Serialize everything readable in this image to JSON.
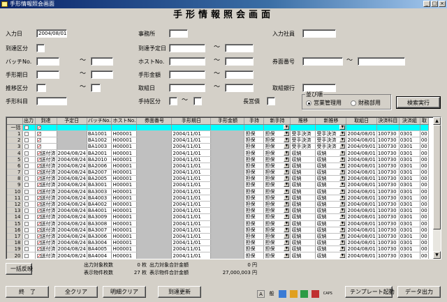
{
  "window": {
    "title": "手形情報照会画面"
  },
  "heading": "手形情報照会画面",
  "filters": {
    "input_date": {
      "label": "入力日",
      "value": "2004/08/01"
    },
    "office": {
      "label": "事務所",
      "value": ""
    },
    "input_staff": {
      "label": "入力社員",
      "value": ""
    },
    "arrival_class": {
      "label": "到達区分",
      "value": ""
    },
    "arrival_plan_date": {
      "label": "到達予定日",
      "from": "",
      "to": ""
    },
    "batch_no": {
      "label": "バッチNo.",
      "from": "",
      "to": ""
    },
    "host_no": {
      "label": "ホストNo.",
      "from": "",
      "to": ""
    },
    "bill_no": {
      "label": "券面番号",
      "from": "",
      "to": ""
    },
    "bill_due": {
      "label": "手形期日",
      "from": "",
      "to": ""
    },
    "bill_amount": {
      "label": "手形金額",
      "from": "",
      "to": ""
    },
    "transfer_class": {
      "label": "推移区分",
      "from": "",
      "to": ""
    },
    "deal_date": {
      "label": "取組日",
      "from": "",
      "to": ""
    },
    "deal_bank": {
      "label": "取組銀行",
      "value": ""
    },
    "bill_subject": {
      "label": "手形科目",
      "value": ""
    },
    "bill_hand_class": {
      "label": "手持区分",
      "from": "",
      "to": ""
    },
    "long_term": {
      "label": "長営債",
      "value": ""
    }
  },
  "sort_order": {
    "label": "並び順",
    "options": [
      "営業管理用",
      "財務部用"
    ],
    "selected": 0
  },
  "buttons": {
    "search": "検索実行",
    "bulk_apply": "一括反映",
    "exit": "終　了",
    "clear_all": "全クリア",
    "clear_detail": "明細クリア",
    "update_arrival": "到達更新",
    "template": "テンプレート起動",
    "data_output": "データ出力"
  },
  "grid": {
    "columns": [
      "",
      "出力",
      "到達",
      "予定日",
      "バッチNo.",
      "ホストNo.",
      "券面番号",
      "手形期日",
      "手形金額",
      "手持",
      "新手持",
      "推移",
      "新推移",
      "取組日",
      "決済科目",
      "決済組",
      "取"
    ],
    "bulk_label": "一括",
    "rows": [
      {
        "n": "1",
        "arr": "",
        "plan": "",
        "batch": "BA1001",
        "host": "H00001",
        "due": "2004/11/01",
        "hold": "担保",
        "nhold": "担保",
        "tr": "受手決済",
        "ntr": "受手決済",
        "deal": "2004/08/01",
        "subj": "100730",
        "grp": "0301",
        "x": "00"
      },
      {
        "n": "2",
        "arr": "",
        "plan": "",
        "batch": "BA1002",
        "host": "H00001",
        "due": "2004/11/01",
        "hold": "担保",
        "nhold": "担保",
        "tr": "受手決済",
        "ntr": "受手決済",
        "deal": "2004/08/01",
        "subj": "100730",
        "grp": "0301",
        "x": "00"
      },
      {
        "n": "3",
        "arr": "",
        "plan": "",
        "batch": "BA1003",
        "host": "H00001",
        "due": "2004/11/01",
        "hold": "担保",
        "nhold": "担保",
        "tr": "受手決済",
        "ntr": "受手決済",
        "deal": "2004/09/01",
        "subj": "100730",
        "grp": "0301",
        "x": "00"
      },
      {
        "n": "4",
        "arr": "送付済",
        "plan": "2004/08/24",
        "batch": "BA2001",
        "host": "H00001",
        "due": "2004/11/01",
        "hold": "担保",
        "nhold": "担保",
        "tr": "収納",
        "ntr": "収納",
        "deal": "2004/08/01",
        "subj": "100730",
        "grp": "0301",
        "x": "00"
      },
      {
        "n": "5",
        "arr": "送付済",
        "plan": "2004/08/24",
        "batch": "BA2010",
        "host": "H00001",
        "due": "2004/11/01",
        "hold": "担保",
        "nhold": "担保",
        "tr": "収納",
        "ntr": "収納",
        "deal": "2004/08/01",
        "subj": "100730",
        "grp": "0301",
        "x": "00"
      },
      {
        "n": "6",
        "arr": "送付済",
        "plan": "2004/08/24",
        "batch": "BA2006",
        "host": "H00001",
        "due": "2004/11/01",
        "hold": "担保",
        "nhold": "担保",
        "tr": "収納",
        "ntr": "収納",
        "deal": "2004/08/01",
        "subj": "100730",
        "grp": "0301",
        "x": "00"
      },
      {
        "n": "7",
        "arr": "送付済",
        "plan": "2004/08/24",
        "batch": "BA2007",
        "host": "H00001",
        "due": "2004/11/01",
        "hold": "担保",
        "nhold": "担保",
        "tr": "収納",
        "ntr": "収納",
        "deal": "2004/08/01",
        "subj": "100730",
        "grp": "0301",
        "x": "00"
      },
      {
        "n": "8",
        "arr": "送付済",
        "plan": "2004/08/24",
        "batch": "BA2005",
        "host": "H00001",
        "due": "2004/11/01",
        "hold": "担保",
        "nhold": "担保",
        "tr": "収納",
        "ntr": "収納",
        "deal": "2004/08/01",
        "subj": "100730",
        "grp": "0301",
        "x": "00"
      },
      {
        "n": "9",
        "arr": "送付済",
        "plan": "2004/08/24",
        "batch": "BA3001",
        "host": "H00001",
        "due": "2004/11/01",
        "hold": "担保",
        "nhold": "担保",
        "tr": "収納",
        "ntr": "収納",
        "deal": "2004/08/01",
        "subj": "100730",
        "grp": "0301",
        "x": "00"
      },
      {
        "n": "10",
        "arr": "送付済",
        "plan": "2004/08/24",
        "batch": "BA3003",
        "host": "H00001",
        "due": "2004/11/01",
        "hold": "担保",
        "nhold": "担保",
        "tr": "収納",
        "ntr": "収納",
        "deal": "2004/08/01",
        "subj": "100730",
        "grp": "0301",
        "x": "00"
      },
      {
        "n": "11",
        "arr": "送付済",
        "plan": "2004/08/24",
        "batch": "BA4003",
        "host": "H00001",
        "due": "2004/11/01",
        "hold": "担保",
        "nhold": "担保",
        "tr": "収納",
        "ntr": "収納",
        "deal": "2004/08/01",
        "subj": "100730",
        "grp": "0301",
        "x": "00"
      },
      {
        "n": "12",
        "arr": "送付済",
        "plan": "2004/08/24",
        "batch": "BA4002",
        "host": "H00001",
        "due": "2004/11/01",
        "hold": "担保",
        "nhold": "担保",
        "tr": "収納",
        "ntr": "収納",
        "deal": "2004/08/01",
        "subj": "100730",
        "grp": "0301",
        "x": "00"
      },
      {
        "n": "13",
        "arr": "送付済",
        "plan": "2004/08/24",
        "batch": "BA4001",
        "host": "H00001",
        "due": "2004/11/01",
        "hold": "担保",
        "nhold": "担保",
        "tr": "収納",
        "ntr": "収納",
        "deal": "2004/08/01",
        "subj": "100730",
        "grp": "0301",
        "x": "00"
      },
      {
        "n": "14",
        "arr": "送付済",
        "plan": "2004/08/24",
        "batch": "BA3009",
        "host": "H00001",
        "due": "2004/11/01",
        "hold": "担保",
        "nhold": "担保",
        "tr": "収納",
        "ntr": "収納",
        "deal": "2004/08/01",
        "subj": "100730",
        "grp": "0301",
        "x": "00"
      },
      {
        "n": "15",
        "arr": "送付済",
        "plan": "2004/08/24",
        "batch": "BA3008",
        "host": "H00001",
        "due": "2004/11/01",
        "hold": "担保",
        "nhold": "担保",
        "tr": "収納",
        "ntr": "収納",
        "deal": "2004/08/01",
        "subj": "100730",
        "grp": "0301",
        "x": "00"
      },
      {
        "n": "16",
        "arr": "送付済",
        "plan": "2004/08/24",
        "batch": "BA3007",
        "host": "H00001",
        "due": "2004/11/01",
        "hold": "担保",
        "nhold": "担保",
        "tr": "収納",
        "ntr": "収納",
        "deal": "2004/08/01",
        "subj": "100730",
        "grp": "0301",
        "x": "00"
      },
      {
        "n": "17",
        "arr": "送付済",
        "plan": "2004/08/24",
        "batch": "BA3006",
        "host": "H00001",
        "due": "2004/11/01",
        "hold": "担保",
        "nhold": "担保",
        "tr": "収納",
        "ntr": "収納",
        "deal": "2004/08/01",
        "subj": "100730",
        "grp": "0301",
        "x": "00"
      },
      {
        "n": "18",
        "arr": "送付済",
        "plan": "2004/08/24",
        "batch": "BA3004",
        "host": "H00001",
        "due": "2004/11/01",
        "hold": "担保",
        "nhold": "担保",
        "tr": "収納",
        "ntr": "収納",
        "deal": "2004/08/01",
        "subj": "100730",
        "grp": "0301",
        "x": "00"
      },
      {
        "n": "19",
        "arr": "送付済",
        "plan": "2004/08/24",
        "batch": "BA4005",
        "host": "H00001",
        "due": "2004/11/01",
        "hold": "担保",
        "nhold": "担保",
        "tr": "収納",
        "ntr": "収納",
        "deal": "2004/08/01",
        "subj": "100730",
        "grp": "0301",
        "x": "00"
      },
      {
        "n": "20",
        "arr": "送付済",
        "plan": "2004/08/24",
        "batch": "BA4004",
        "host": "H00001",
        "due": "2004/11/01",
        "hold": "担保",
        "nhold": "担保",
        "tr": "収納",
        "ntr": "収納",
        "deal": "2004/08/01",
        "subj": "100730",
        "grp": "0301",
        "x": "00"
      }
    ]
  },
  "summary": {
    "output_count_label": "出力対象枚数",
    "output_count": "0 枚",
    "output_amount_label": "出力対象合計金額",
    "output_amount": "0 円",
    "display_count_label": "表示物件枚数",
    "display_count": "27 枚",
    "display_amount_label": "表示物件合計金額",
    "display_amount": "27,000,003 円"
  },
  "tray": {
    "ime": "般",
    "caps": "CAPS"
  }
}
